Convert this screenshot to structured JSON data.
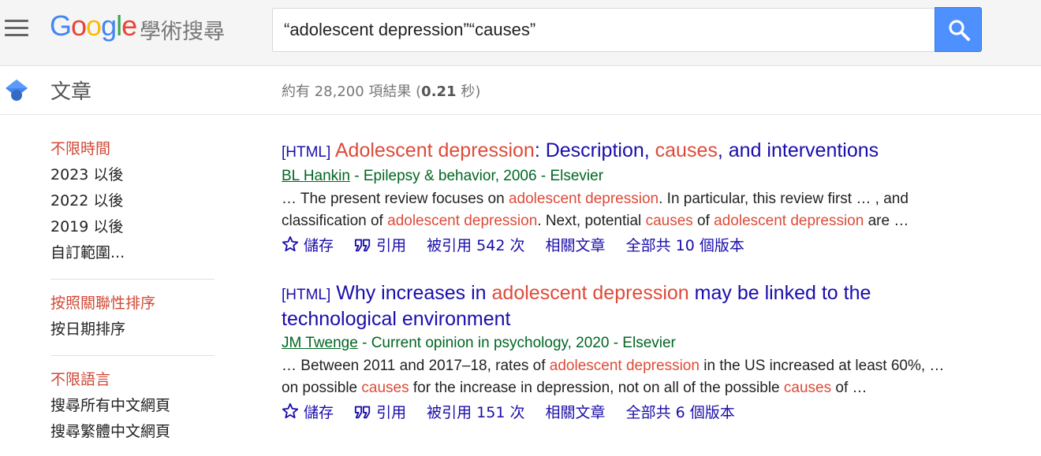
{
  "header": {
    "logo_letters": [
      "G",
      "o",
      "o",
      "g",
      "l",
      "e"
    ],
    "logo_sub": "學術搜尋",
    "search_value": "“adolescent depression”“causes”"
  },
  "subheader": {
    "section_title": "文章",
    "stats_prefix": "約有 28,200 項結果 (",
    "stats_time": "0.21",
    "stats_suffix": " 秒)"
  },
  "sidebar": {
    "time": [
      "不限時間",
      "2023 以後",
      "2022 以後",
      "2019 以後",
      "自訂範圍..."
    ],
    "sort": [
      "按照關聯性排序",
      "按日期排序"
    ],
    "lang": [
      "不限語言",
      "搜尋所有中文網頁",
      "搜尋繁體中文網頁"
    ]
  },
  "results": [
    {
      "tag": "[HTML]",
      "title_parts": [
        {
          "t": "Adolescent depression",
          "hl": true
        },
        {
          "t": ": Description, ",
          "hl": false
        },
        {
          "t": "causes",
          "hl": true
        },
        {
          "t": ", and interventions",
          "hl": false
        }
      ],
      "author": "BL Hankin",
      "source": " - Epilepsy & behavior, 2006 - Elsevier",
      "snippet_parts": [
        {
          "t": "… The present review focuses on ",
          "hl": false
        },
        {
          "t": "adolescent depression",
          "hl": true
        },
        {
          "t": ". In particular, this review first … , and classification of ",
          "hl": false
        },
        {
          "t": "adolescent depression",
          "hl": true
        },
        {
          "t": ". Next, potential ",
          "hl": false
        },
        {
          "t": "causes",
          "hl": true
        },
        {
          "t": " of ",
          "hl": false
        },
        {
          "t": "adolescent depression",
          "hl": true
        },
        {
          "t": " are …",
          "hl": false
        }
      ],
      "save": "儲存",
      "cite": "引用",
      "cited_by": "被引用 542 次",
      "related": "相關文章",
      "versions": "全部共 10 個版本"
    },
    {
      "tag": "[HTML]",
      "title_parts": [
        {
          "t": "Why increases in ",
          "hl": false
        },
        {
          "t": "adolescent depression",
          "hl": true
        },
        {
          "t": " may be linked to the technological environment",
          "hl": false
        }
      ],
      "author": "JM Twenge",
      "source": " - Current opinion in psychology, 2020 - Elsevier",
      "snippet_parts": [
        {
          "t": "… Between 2011 and 2017–18, rates of ",
          "hl": false
        },
        {
          "t": "adolescent depression",
          "hl": true
        },
        {
          "t": " in the US increased at least 60%, … on possible ",
          "hl": false
        },
        {
          "t": "causes",
          "hl": true
        },
        {
          "t": " for the increase in depression, not on all of the possible ",
          "hl": false
        },
        {
          "t": "causes",
          "hl": true
        },
        {
          "t": " of …",
          "hl": false
        }
      ],
      "save": "儲存",
      "cite": "引用",
      "cited_by": "被引用 151 次",
      "related": "相關文章",
      "versions": "全部共 6 個版本"
    }
  ],
  "colors": {
    "link": "#1a0dab",
    "highlight": "#dd4b39",
    "source": "#006621",
    "active_filter": "#d14836",
    "search_button": "#4d90fe"
  },
  "icons": {
    "menu": "hamburger-menu-icon",
    "search": "magnifier-icon",
    "section": "graduation-cap-icon",
    "save": "star-outline-icon",
    "cite": "double-quote-icon"
  }
}
